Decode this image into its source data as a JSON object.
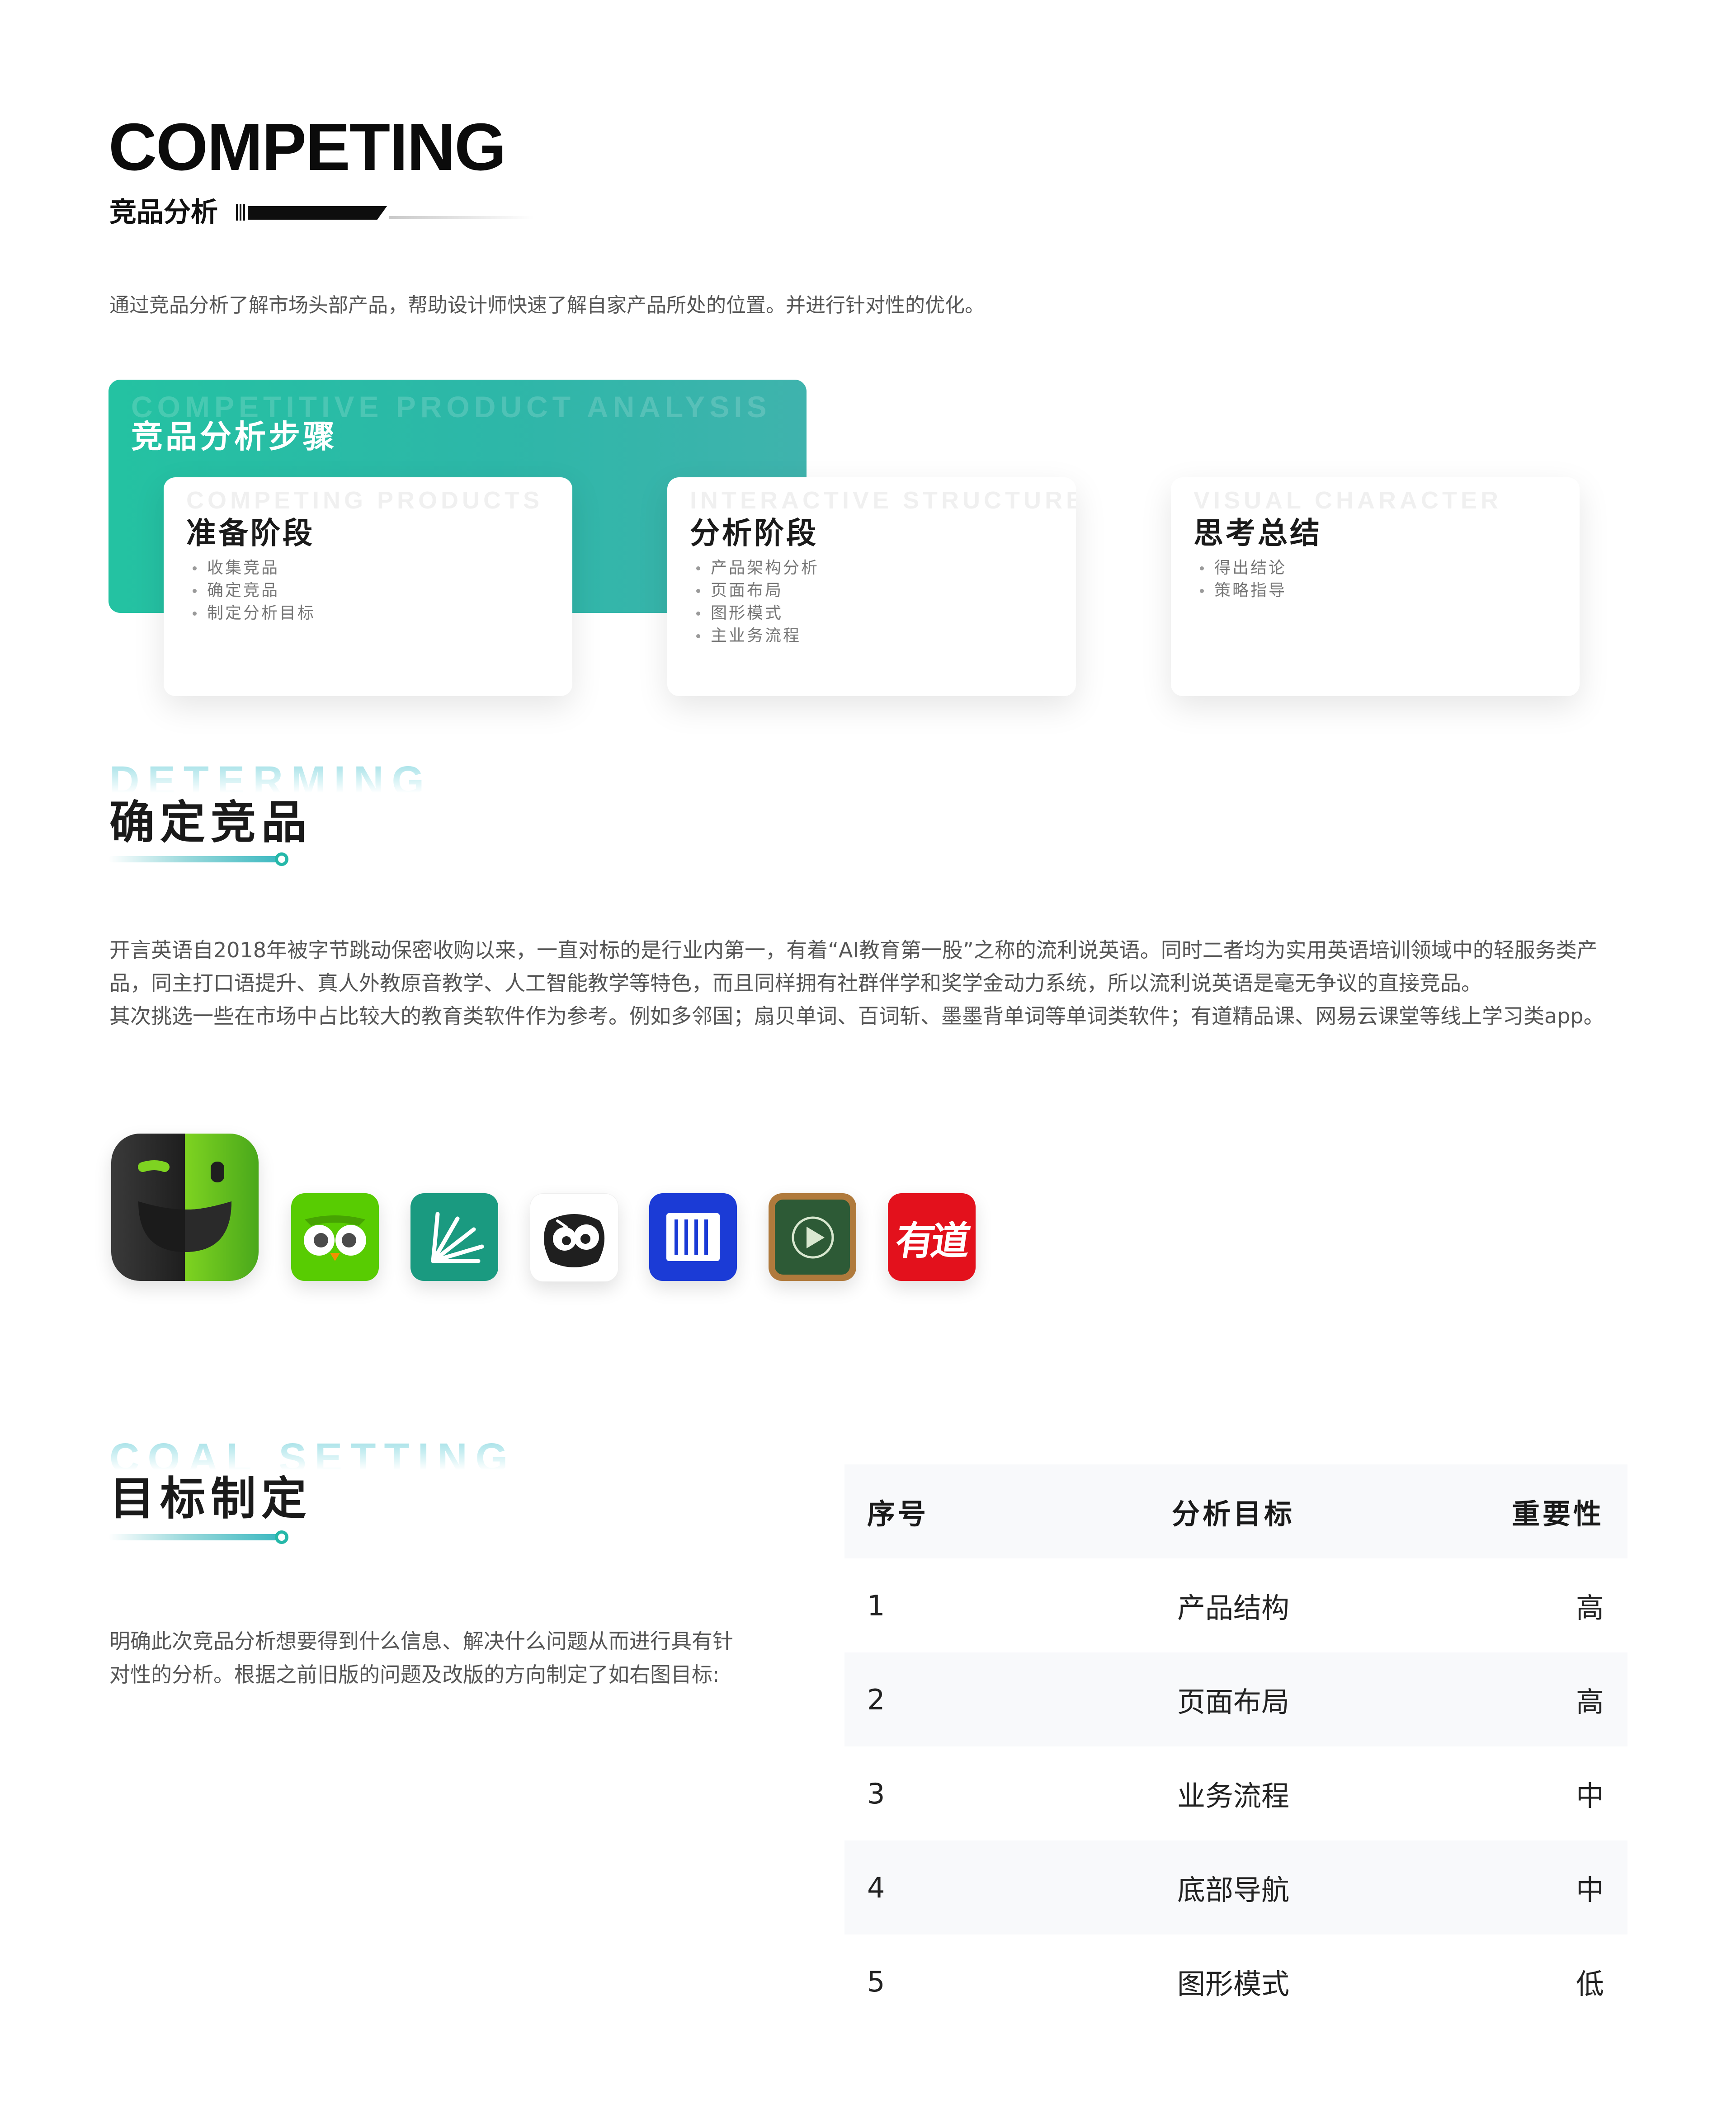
{
  "header": {
    "title": "COMPETING",
    "subtitle": "竞品分析",
    "intro": "通过竞品分析了解市场头部产品，帮助设计师快速了解自家产品所处的位置。并进行针对性的优化。"
  },
  "steps": {
    "ghost": "COMPETITIVE PRODUCT ANALYSIS",
    "heading": "竞品分析步骤",
    "cards": [
      {
        "ghost": "COMPETING PRODUCTS",
        "title": "准备阶段",
        "items": [
          "收集竞品",
          "确定竞品",
          "制定分析目标"
        ]
      },
      {
        "ghost": "INTERACTIVE STRUCTURE",
        "title": "分析阶段",
        "items": [
          "产品架构分析",
          "页面布局",
          "图形模式",
          "主业务流程"
        ]
      },
      {
        "ghost": "VISUAL CHARACTER",
        "title": "思考总结",
        "items": [
          "得出结论",
          "策略指导"
        ]
      }
    ]
  },
  "determining": {
    "ghost": "DETERMING",
    "title": "确定竞品",
    "paragraphs": [
      "开言英语自2018年被字节跳动保密收购以来，一直对标的是行业内第一，有着“AI教育第一股”之称的流利说英语。同时二者均为实用英语培训领域中的轻服务类产品，同主打口语提升、真人外教原音教学、人工智能教学等特色，而且同样拥有社群伴学和奖学金动力系统，所以流利说英语是毫无争议的直接竞品。",
      "其次挑选一些在市场中占比较大的教育类软件作为参考。例如多邻国；扇贝单词、百词斩、墨墨背单词等单词类软件；有道精品课、网易云课堂等线上学习类app。"
    ],
    "youdao_logo_text": "有道",
    "colors": {
      "kaiyan_green": "#7ed321",
      "duolingo_green": "#58cc02",
      "shanbay_teal": "#1a9a80",
      "baicizhan_white": "#ffffff",
      "momo_blue": "#1b3bd6",
      "netease_board": "#2d5a36",
      "youdao_red": "#e3111c"
    }
  },
  "goals": {
    "ghost": "COAL SETTING",
    "title": "目标制定",
    "description": "明确此次竞品分析想要得到什么信息、解决什么问题从而进行具有针对性的分析。根据之前旧版的问题及改版的方向制定了如右图目标:",
    "table": {
      "headers": [
        "序号",
        "分析目标",
        "重要性"
      ],
      "rows": [
        [
          "1",
          "产品结构",
          "高"
        ],
        [
          "2",
          "页面布局",
          "高"
        ],
        [
          "3",
          "业务流程",
          "中"
        ],
        [
          "4",
          "底部导航",
          "中"
        ],
        [
          "5",
          "图形模式",
          "低"
        ]
      ]
    }
  },
  "accent_color": "#25b8a9"
}
